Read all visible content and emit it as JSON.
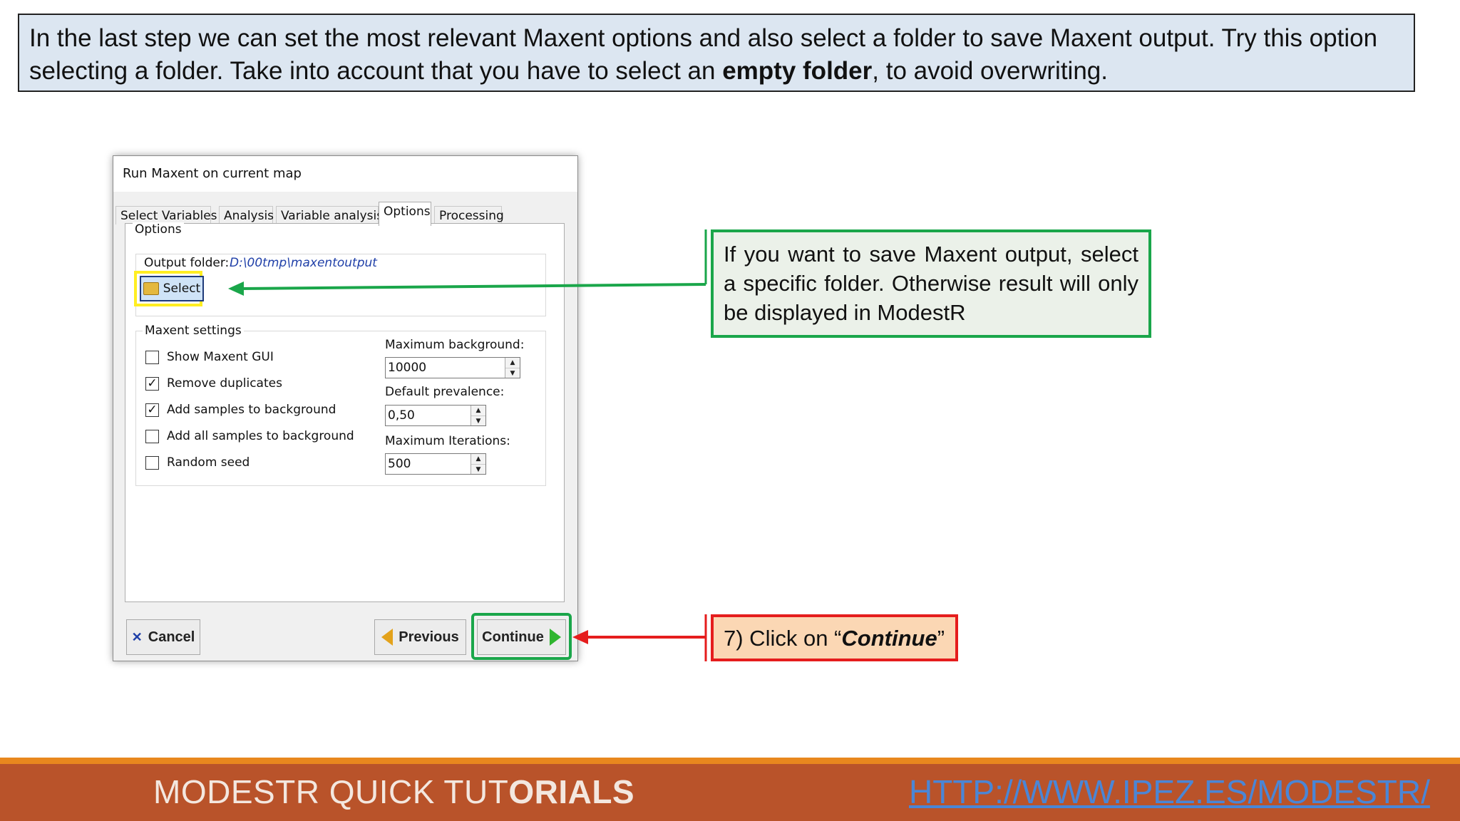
{
  "instruction": {
    "before": "In the last step we can set the most relevant Maxent options and also select a folder to save Maxent output. Try this option selecting a folder. Take into account that you have to select an ",
    "bold": "empty folder",
    "after": ", to avoid overwriting."
  },
  "dialog": {
    "title": "Run Maxent on current map",
    "tabs": [
      "Select Variables",
      "Analysis",
      "Variable analysis",
      "Options",
      "Processing"
    ],
    "active_tab": "Options",
    "options_group": "Options",
    "output_folder_label": "Output folder:",
    "output_folder_value": "D:\\00tmp\\maxentoutput",
    "select_button": "Select",
    "maxent_settings_group": "Maxent settings",
    "checkboxes": [
      {
        "label": "Show Maxent GUI",
        "checked": false
      },
      {
        "label": "Remove duplicates",
        "checked": true
      },
      {
        "label": "Add samples to background",
        "checked": true
      },
      {
        "label": "Add all samples to background",
        "checked": false
      },
      {
        "label": "Random seed",
        "checked": false
      }
    ],
    "max_background_label": "Maximum background:",
    "max_background_value": "10000",
    "default_prevalence_label": "Default prevalence:",
    "default_prevalence_value": "0,50",
    "max_iterations_label": "Maximum Iterations:",
    "max_iterations_value": "500",
    "cancel_button": "Cancel",
    "previous_button": "Previous",
    "continue_button": "Continue"
  },
  "callouts": {
    "select_note": "If you want to save Maxent output, select a specific folder. Otherwise result will only be displayed in ModestR",
    "step_prefix": "7) Click on “",
    "step_emph": "Continue",
    "step_suffix": "”"
  },
  "colors": {
    "highlight_yellow": "#ffee22",
    "highlight_green": "#1aa64a",
    "highlight_red": "#e51d1d",
    "footer": "#b9532a"
  },
  "footer": {
    "title_light": "MODESTR QUICK TUT",
    "title_bold": "ORIALS",
    "link": "HTTP://WWW.IPEZ.ES/MODESTR/"
  }
}
